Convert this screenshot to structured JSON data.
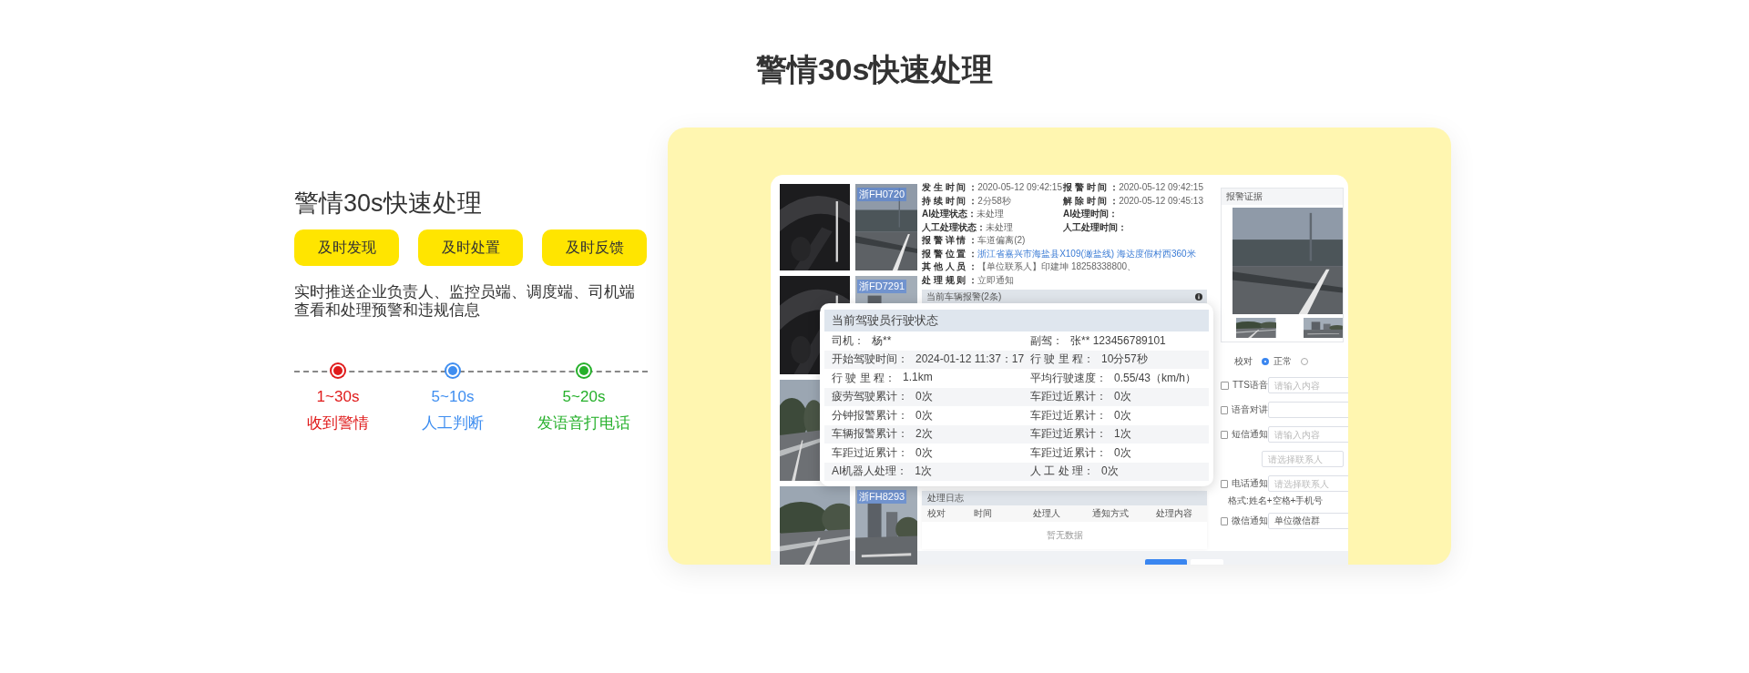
{
  "page_title": "警情30s快速处理",
  "feature": {
    "title": "警情30s快速处理",
    "tags": [
      "及时发现",
      "及时处置",
      "及时反馈"
    ],
    "description": "实时推送企业负责人、监控员端、调度端、司机端查看和处理预警和违规信息",
    "timeline": [
      {
        "time": "1~30s",
        "label": "收到警情",
        "color": "#e01b1b"
      },
      {
        "time": "5~10s",
        "label": "人工判断",
        "color": "#3f8ef0"
      },
      {
        "time": "5~20s",
        "label": "发语音打电话",
        "color": "#25b02a"
      }
    ]
  },
  "screenshot": {
    "thumbnail_columns": [
      [
        {
          "kind": "picture"
        },
        {
          "kind": "picture"
        },
        {
          "kind": "picture"
        },
        {
          "kind": "picture"
        }
      ],
      [
        {
          "kind": "picture",
          "plate": "浙FH0720"
        },
        {
          "kind": "picture",
          "plate": "浙FD7291"
        },
        {
          "kind": "picture",
          "plate": "浙FH8293"
        }
      ]
    ],
    "alarm_info": [
      [
        {
          "label": "发 生 时 间 ：",
          "value": "2020-05-12 09:42:15"
        },
        {
          "label": "报 警 时 间 ：",
          "value": "2020-05-12 09:42:15"
        }
      ],
      [
        {
          "label": "持 续 时 间 ：",
          "value": "2分58秒"
        },
        {
          "label": "解 除 时 间 ：",
          "value": "2020-05-12 09:45:13"
        }
      ],
      [
        {
          "label": "AI处理状态：",
          "value": "未处理"
        },
        {
          "label": "AI处理时间："
        }
      ],
      [
        {
          "label": "人工处理状态：",
          "value": "未处理"
        },
        {
          "label": "人工处理时间："
        }
      ],
      [
        {
          "label": "报 警 详 情 ：",
          "value": "车道偏离(2)"
        }
      ],
      [
        {
          "label": "报 警 位 置 ：",
          "value": "浙江省嘉兴市海盐县X109(澉盐线) 海达度假村西360米",
          "kind": "link"
        }
      ],
      [
        {
          "label": "其 他 人 员 ：",
          "value": "【单位联系人】印建坤 18258338800、"
        }
      ],
      [
        {
          "label": "处 理 规 则 ：",
          "value": "立即通知"
        }
      ]
    ],
    "alarm_bar": "当前车辆报警(2条)",
    "driver_status": {
      "title": "当前驾驶员行驶状态",
      "rows": [
        [
          {
            "label": "司机：",
            "value": "杨**"
          },
          {
            "label": "副驾：",
            "value": "张**  123456789101"
          }
        ],
        [
          {
            "label": "开始驾驶时间：",
            "value": "2024-01-12 11:37：17"
          },
          {
            "label": "行 驶 里 程：",
            "value": "10分57秒"
          }
        ],
        [
          {
            "label": "行 驶 里 程：",
            "value": "1.1km"
          },
          {
            "label": "平均行驶速度：",
            "value": "0.55/43（km/h）"
          }
        ],
        [
          {
            "label": "疲劳驾驶累计：",
            "value": "0次"
          },
          {
            "label": "车距过近累计：",
            "value": "0次"
          }
        ],
        [
          {
            "label": "分钟报警累计：",
            "value": "0次"
          },
          {
            "label": "车距过近累计：",
            "value": "0次"
          }
        ],
        [
          {
            "label": "车辆报警累计：",
            "value": "2次"
          },
          {
            "label": "车距过近累计：",
            "value": "1次"
          }
        ],
        [
          {
            "label": "车距过近累计：",
            "value": "0次"
          },
          {
            "label": "车距过近累计：",
            "value": "0次"
          }
        ],
        [
          {
            "label": "AI机器人处理：",
            "value": "1次"
          },
          {
            "label": "人 工 处 理：",
            "value": "0次"
          }
        ]
      ]
    },
    "log": {
      "title": "处理日志",
      "columns": [
        "校对",
        "时间",
        "处理人",
        "通知方式",
        "处理内容"
      ],
      "empty_text": "暂无数据"
    },
    "evidence": {
      "title": "报警证据"
    },
    "review": {
      "label": "校对",
      "options": [
        {
          "label": "正常",
          "selected": true
        },
        {
          "selected": false
        }
      ]
    },
    "notifications": [
      {
        "label": "TTS语音",
        "checked": false,
        "placeholder": "请输入内容"
      },
      {
        "label": "语音对讲",
        "checked": false
      },
      {
        "label": "短信通知",
        "checked": false,
        "placeholder": "请输入内容"
      },
      {
        "placeholder": "请选择联系人"
      },
      {
        "label": "电话通知",
        "checked": false,
        "placeholder": "请选择联系人",
        "hint": "格式:姓名+空格+手机号"
      },
      {
        "label": "微信通知",
        "checked": false,
        "value": "单位微信群"
      }
    ]
  }
}
